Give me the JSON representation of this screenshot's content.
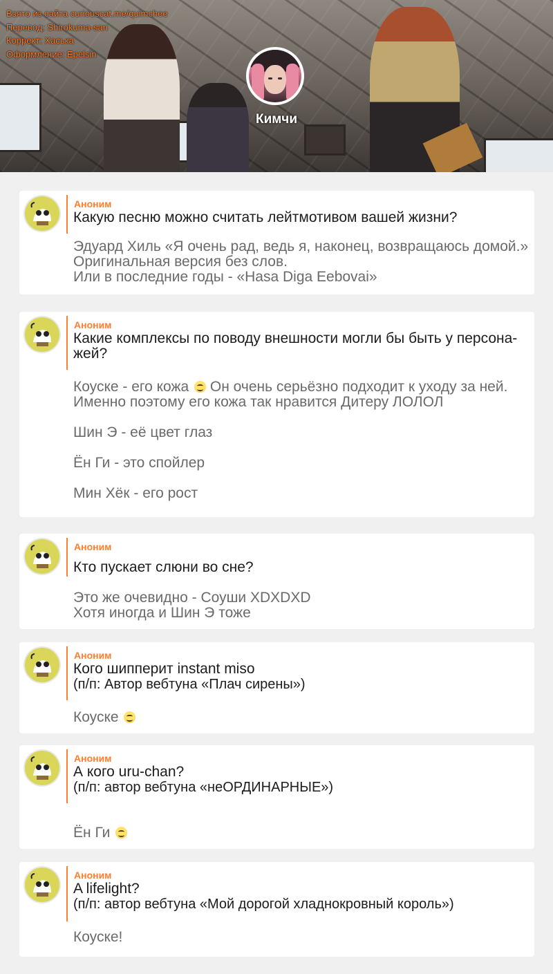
{
  "credits": [
    "Взято из сайта curiouscat.me/quimchee",
    "Перевод: Shirokuma-san",
    "Коррект: Хаська",
    "Оформление: Epelsin"
  ],
  "profile": {
    "name": "Кимчи"
  },
  "accent_color": "#ff7d2c",
  "posts": [
    {
      "asker": "Аноним",
      "question": [
        "Какую песню можно считать лейтмотивом вашей жизни?"
      ],
      "answer": [
        "Эдуард Хиль «Я очень рад, ведь я, наконец, возвращаюсь домой.»",
        "Оригинальная версия без слов.",
        "Или в последние годы - «Hasa Diga Eebovai»"
      ]
    },
    {
      "asker": "Аноним",
      "question": [
        "Какие комплексы по поводу внешности могли бы быть у персона-",
        "жей?"
      ],
      "answer": [
        "Коуске - его кожа",
        "Он очень серьёзно подходит к уходу за ней.",
        "Именно поэтому его кожа так нравится Дитеру ЛОЛОЛ",
        "Шин Э - её цвет глаз",
        "Ён Ги - это спойлер",
        "Мин Хёк - его рост"
      ]
    },
    {
      "asker": "Аноним",
      "question": [
        "Кто пускает слюни во сне?"
      ],
      "answer": [
        "Это же очевидно - Соуши XDXDXD",
        "Хотя иногда и Шин Э тоже"
      ]
    },
    {
      "asker": "Аноним",
      "question": [
        "Кого шипперит instant miso",
        "(п/п: Автор вебтуна «Плач сирены»)"
      ],
      "answer": [
        "Коуске"
      ]
    },
    {
      "asker": "Аноним",
      "question": [
        "А кого uru-chan?",
        "(п/п: автор вебтуна «неОРДИНАРНЫЕ»)"
      ],
      "answer": [
        "Ён Ги"
      ]
    },
    {
      "asker": "Аноним",
      "question": [
        "A lifelight?",
        "(п/п: автор вебтуна «Мой дорогой хладнокровный король»)"
      ],
      "answer": [
        "Коуске!"
      ]
    }
  ]
}
